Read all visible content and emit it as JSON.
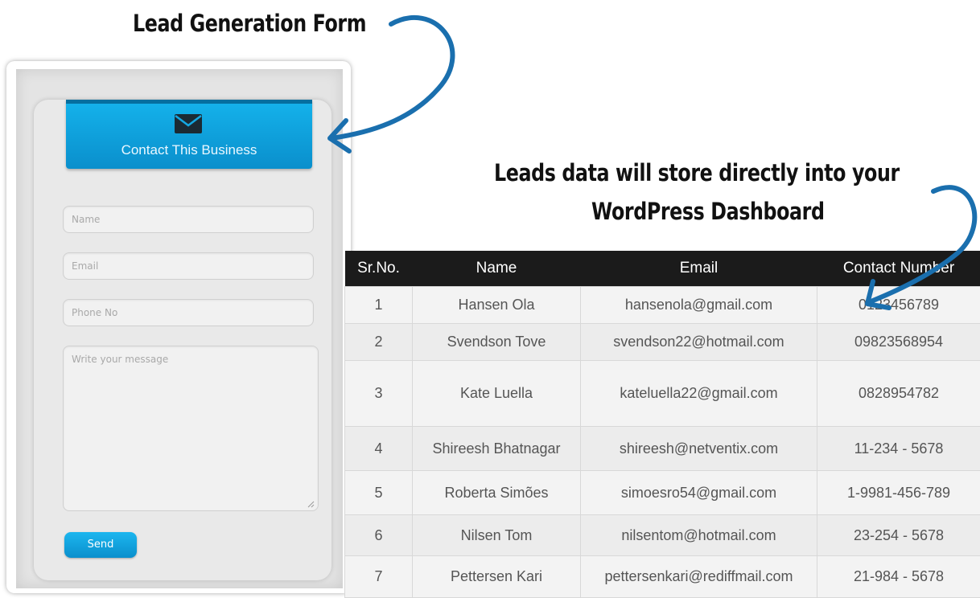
{
  "captions": {
    "form": "Lead Generation Form",
    "leads_line1": "Leads data will store directly into your",
    "leads_line2": "WordPress Dashboard"
  },
  "form": {
    "title": "Contact This Business",
    "icon": "envelope-icon",
    "fields": {
      "name_placeholder": "Name",
      "email_placeholder": "Email",
      "phone_placeholder": "Phone No",
      "message_placeholder": "Write your message"
    },
    "send_label": "Send",
    "accent_color": "#0a9ad9"
  },
  "table": {
    "columns": [
      "Sr.No.",
      "Name",
      "Email",
      "Contact Number"
    ],
    "rows": [
      [
        "1",
        "Hansen Ola",
        "hansenola@gmail.com",
        "0123456789"
      ],
      [
        "2",
        "Svendson Tove",
        "svendson22@hotmail.com",
        "09823568954"
      ],
      [
        "3",
        "Kate Luella",
        "kateluella22@gmail.com",
        "0828954782"
      ],
      [
        "4",
        "Shireesh Bhatnagar",
        "shireesh@netventix.com",
        "11-234 - 5678"
      ],
      [
        "5",
        "Roberta Simões",
        "simoesro54@gmail.com",
        "1-9981-456-789"
      ],
      [
        "6",
        "Nilsen Tom",
        "nilsentom@hotmail.com",
        "23-254 - 5678"
      ],
      [
        "7",
        "Pettersen Kari",
        "pettersenkari@rediffmail.com",
        "21-984 - 5678"
      ]
    ],
    "header_color": "#1b1b1b"
  },
  "arrow_color": "#1a6fae"
}
